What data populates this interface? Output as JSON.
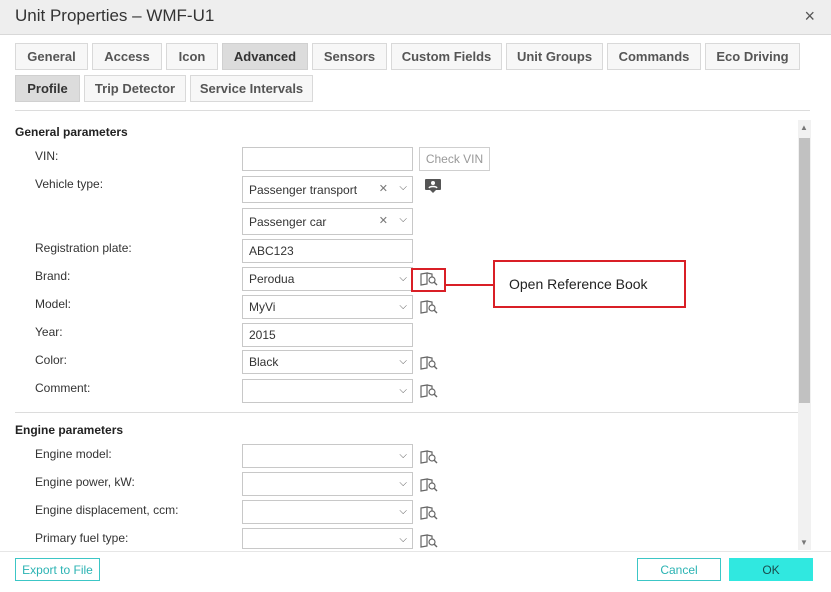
{
  "window": {
    "title": "Unit Properties – WMF-U1",
    "close_glyph": "×"
  },
  "tabs_row1": [
    "General",
    "Access",
    "Icon",
    "Advanced",
    "Sensors",
    "Custom Fields",
    "Unit Groups",
    "Commands",
    "Eco Driving"
  ],
  "tabs_row2": [
    "Profile",
    "Trip Detector",
    "Service Intervals"
  ],
  "active_tabs": [
    "Advanced",
    "Profile"
  ],
  "sections": {
    "general": "General parameters",
    "engine": "Engine parameters"
  },
  "general_fields": {
    "vin_label": "VIN:",
    "vin_value": "",
    "check_vin": "Check VIN",
    "vehicle_type_label": "Vehicle type:",
    "vehicle_type_value": "Passenger transport",
    "vehicle_subtype_value": "Passenger car",
    "registration_label": "Registration plate:",
    "registration_value": "ABC123",
    "brand_label": "Brand:",
    "brand_value": "Perodua",
    "model_label": "Model:",
    "model_value": "MyVi",
    "year_label": "Year:",
    "year_value": "2015",
    "color_label": "Color:",
    "color_value": "Black",
    "comment_label": "Comment:",
    "comment_value": ""
  },
  "engine_fields": {
    "engine_model_label": "Engine model:",
    "engine_power_label": "Engine power, kW:",
    "engine_displacement_label": "Engine displacement, ccm:",
    "primary_fuel_label": "Primary fuel type:"
  },
  "callout": {
    "text": "Open Reference Book",
    "color": "#d91f26"
  },
  "footer": {
    "export": "Export to File",
    "cancel": "Cancel",
    "ok": "OK"
  },
  "colors": {
    "accent": "#30e8e0",
    "accent_text": "#2bb3b3"
  }
}
